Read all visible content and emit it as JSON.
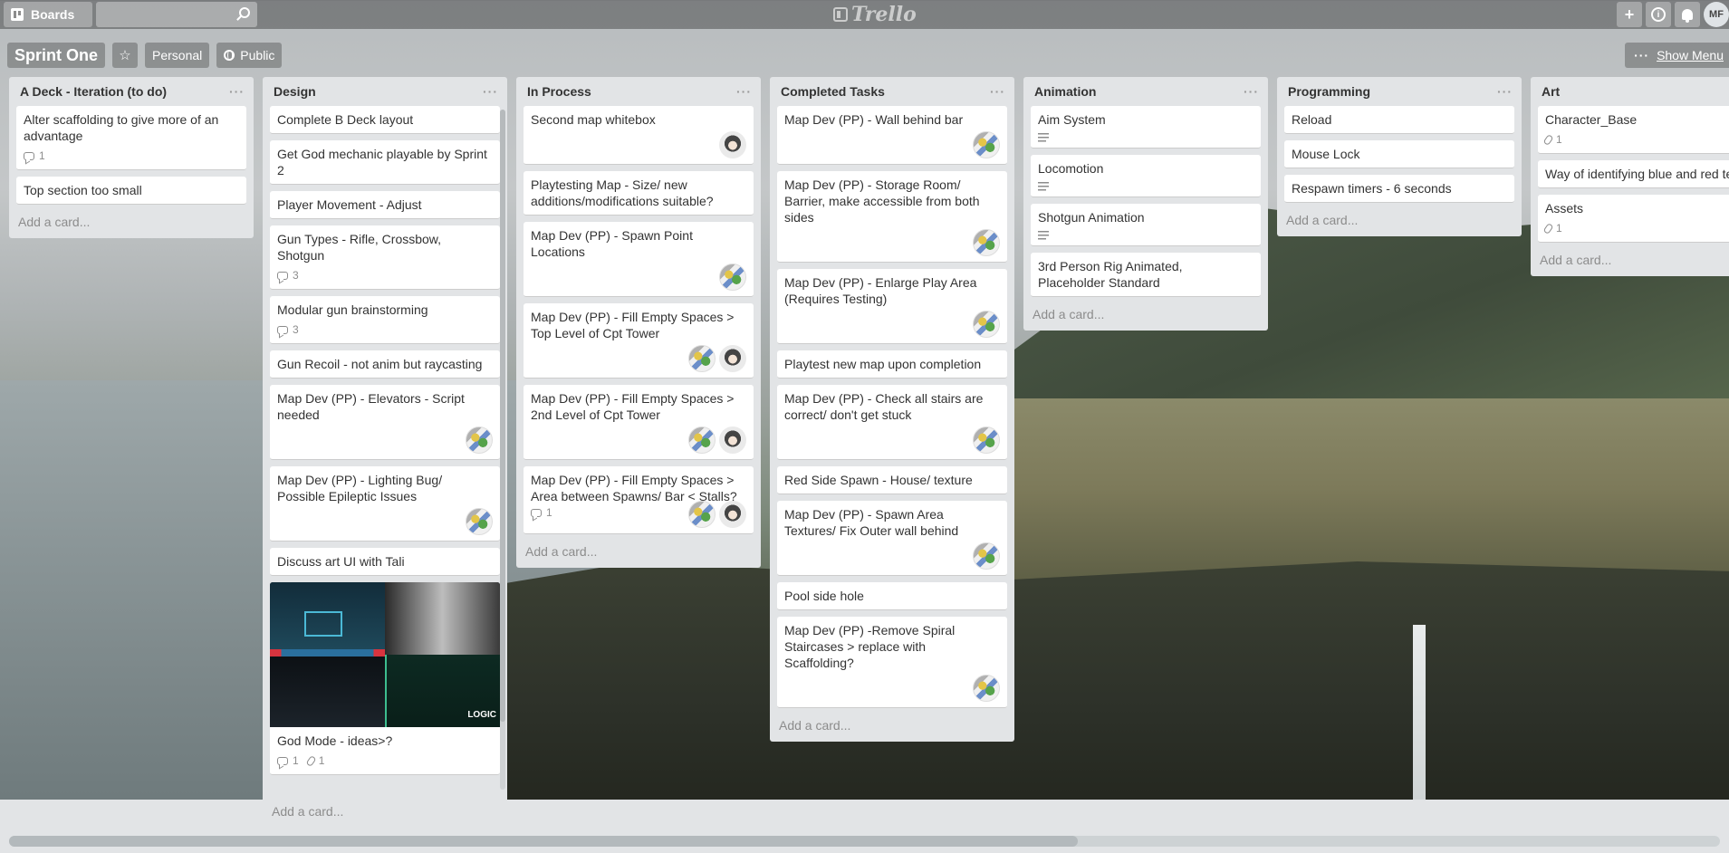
{
  "header": {
    "boards_label": "Boards",
    "search_placeholder": "",
    "logo": "Trello",
    "avatar_initials": "MF"
  },
  "board": {
    "title": "Sprint One",
    "team_label": "Personal",
    "visibility_label": "Public",
    "show_menu_label": "Show Menu",
    "add_card_label": "Add a card..."
  },
  "lists": [
    {
      "title": "A Deck - Iteration (to do)",
      "cards": [
        {
          "title": "Alter scaffolding to give more of an advantage",
          "comments": "1"
        },
        {
          "title": "Top section too small"
        }
      ]
    },
    {
      "title": "Design",
      "cards": [
        {
          "title": "Complete B Deck layout"
        },
        {
          "title": "Get God mechanic playable by Sprint 2"
        },
        {
          "title": "Player Movement - Adjust"
        },
        {
          "title": "Gun Types - Rifle, Crossbow, Shotgun",
          "comments": "3"
        },
        {
          "title": "Modular gun brainstorming",
          "comments": "3"
        },
        {
          "title": "Gun Recoil - not anim but raycasting"
        },
        {
          "title": "Map Dev (PP) - Elevators - Script needed",
          "members": [
            "pp"
          ]
        },
        {
          "title": "Map Dev (PP) - Lighting Bug/ Possible Epileptic Issues",
          "members": [
            "pp"
          ]
        },
        {
          "title": "Discuss art UI with Tali"
        },
        {
          "title": "God Mode - ideas>?",
          "comments": "1",
          "attachments": "1",
          "cover": true
        }
      ]
    },
    {
      "title": "In Process",
      "cards": [
        {
          "title": "Second map whitebox",
          "members": [
            "girl"
          ]
        },
        {
          "title": "Playtesting Map - Size/ new additions/modifications suitable?"
        },
        {
          "title": "Map Dev (PP) - Spawn Point Locations",
          "members": [
            "pp"
          ]
        },
        {
          "title": "Map Dev (PP) - Fill Empty Spaces > Top Level of Cpt Tower",
          "members": [
            "pp",
            "girl"
          ]
        },
        {
          "title": "Map Dev (PP) - Fill Empty Spaces > 2nd Level of Cpt Tower",
          "members": [
            "pp",
            "girl"
          ]
        },
        {
          "title": "Map Dev (PP) - Fill Empty Spaces > Area between Spawns/ Bar < Stalls?",
          "comments": "1",
          "members": [
            "pp",
            "girl"
          ]
        }
      ]
    },
    {
      "title": "Completed Tasks",
      "cards": [
        {
          "title": "Map Dev (PP) - Wall behind bar",
          "members": [
            "pp"
          ]
        },
        {
          "title": "Map Dev (PP) - Storage Room/ Barrier, make accessible from both sides",
          "members": [
            "pp"
          ]
        },
        {
          "title": "Map Dev (PP) - Enlarge Play Area (Requires Testing)",
          "members": [
            "pp"
          ]
        },
        {
          "title": "Playtest new map upon completion"
        },
        {
          "title": "Map Dev (PP) - Check all stairs are correct/ don't get stuck",
          "members": [
            "pp"
          ]
        },
        {
          "title": "Red Side Spawn - House/ texture"
        },
        {
          "title": "Map Dev (PP) - Spawn Area Textures/ Fix Outer wall behind",
          "members": [
            "pp"
          ]
        },
        {
          "title": "Pool side hole"
        },
        {
          "title": "Map Dev (PP) -Remove Spiral Staircases > replace with Scaffolding?",
          "members": [
            "pp"
          ]
        }
      ]
    },
    {
      "title": "Animation",
      "cards": [
        {
          "title": "Aim System",
          "description": true
        },
        {
          "title": "Locomotion",
          "description": true
        },
        {
          "title": "Shotgun Animation",
          "description": true
        },
        {
          "title": "3rd Person Rig Animated, Placeholder Standard"
        }
      ]
    },
    {
      "title": "Programming",
      "cards": [
        {
          "title": "Reload"
        },
        {
          "title": "Mouse Lock"
        },
        {
          "title": "Respawn timers - 6 seconds"
        }
      ]
    },
    {
      "title": "Art",
      "cards": [
        {
          "title": "Character_Base",
          "attachments": "1"
        },
        {
          "title": "Way of identifying blue and red te"
        },
        {
          "title": "Assets",
          "attachments": "1"
        }
      ]
    }
  ]
}
